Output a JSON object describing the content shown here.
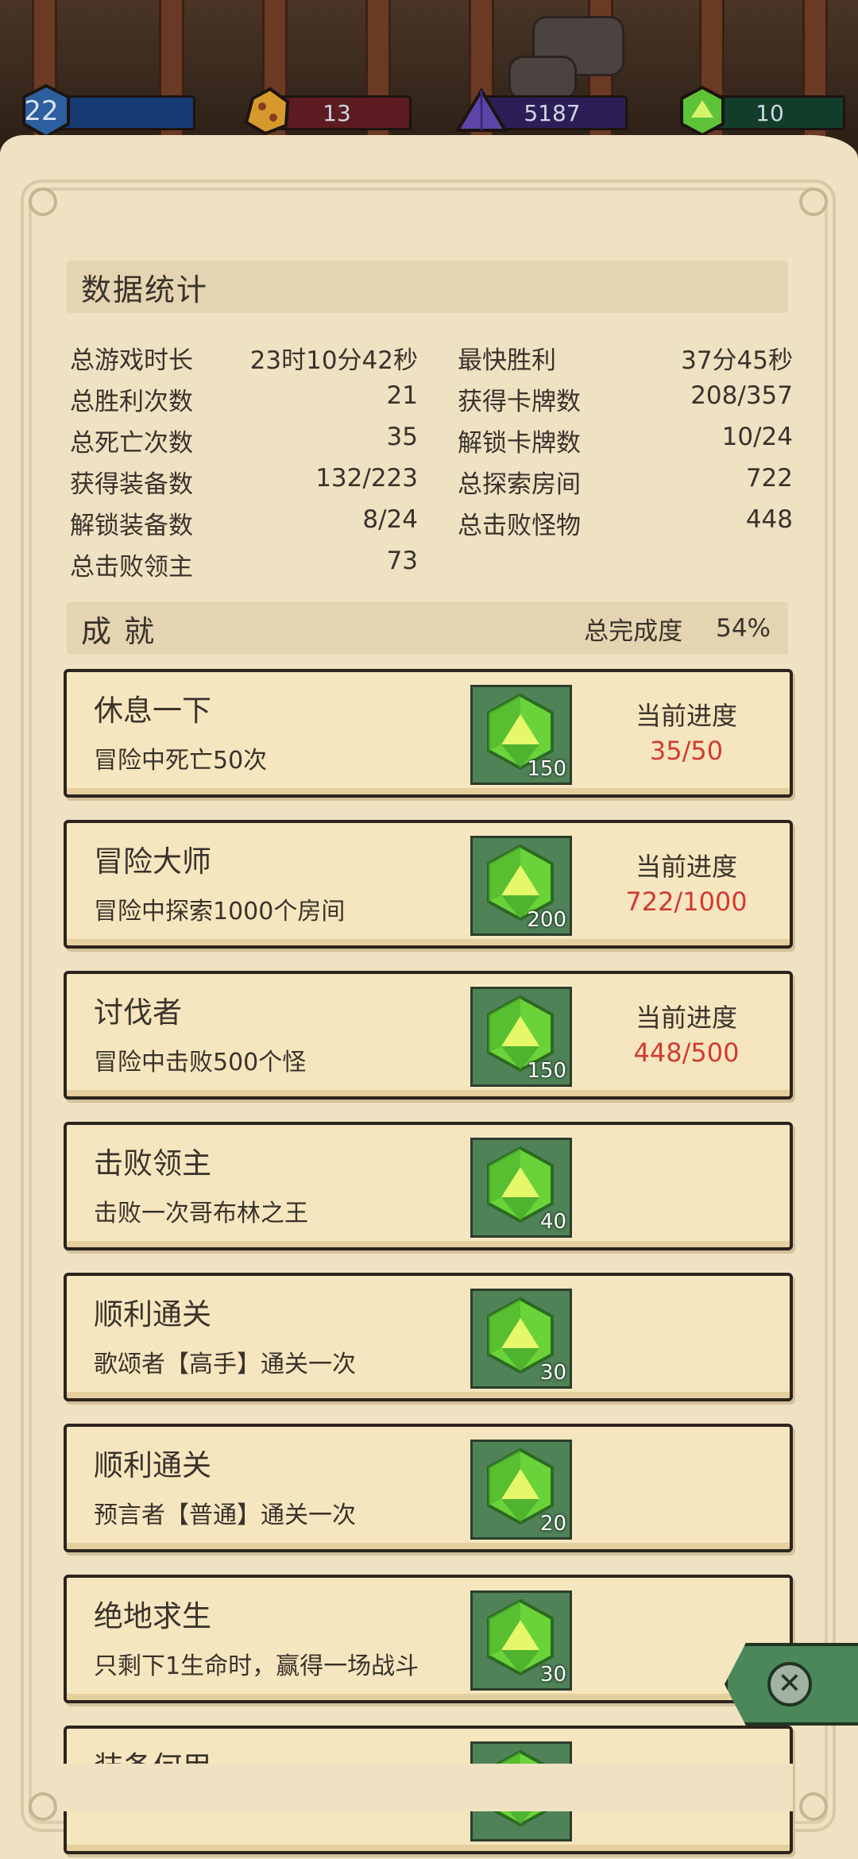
{
  "resources": {
    "level": "22",
    "gold": "13",
    "crystal": "5187",
    "gem": "10",
    "colors": {
      "level": "#173a72",
      "gold": "#5d1b22",
      "crystal": "#2c1f58",
      "gem": "#123d2a"
    }
  },
  "stats": {
    "title": "数据统计",
    "left": [
      {
        "label": "总游戏时长",
        "value": "23时10分42秒"
      },
      {
        "label": "总胜利次数",
        "value": "21"
      },
      {
        "label": "总死亡次数",
        "value": "35"
      },
      {
        "label": "获得装备数",
        "value": "132/223"
      },
      {
        "label": "解锁装备数",
        "value": "8/24"
      },
      {
        "label": "总击败领主",
        "value": "73"
      }
    ],
    "right": [
      {
        "label": "最快胜利",
        "value": "37分45秒"
      },
      {
        "label": "获得卡牌数",
        "value": "208/357"
      },
      {
        "label": "解锁卡牌数",
        "value": "10/24"
      },
      {
        "label": "总探索房间",
        "value": "722"
      },
      {
        "label": "总击败怪物",
        "value": "448"
      }
    ]
  },
  "achievements": {
    "title": "成 就",
    "completion_label": "总完成度",
    "completion_value": "54%",
    "progress_label": "当前进度",
    "items": [
      {
        "title": "休息一下",
        "desc": "冒险中死亡50次",
        "reward": "150",
        "progress": "35/50"
      },
      {
        "title": "冒险大师",
        "desc": "冒险中探索1000个房间",
        "reward": "200",
        "progress": "722/1000"
      },
      {
        "title": "讨伐者",
        "desc": "冒险中击败500个怪",
        "reward": "150",
        "progress": "448/500"
      },
      {
        "title": "击败领主",
        "desc": "击败一次哥布林之王",
        "reward": "40",
        "progress": ""
      },
      {
        "title": "顺利通关",
        "desc": "歌颂者【高手】通关一次",
        "reward": "30",
        "progress": ""
      },
      {
        "title": "顺利通关",
        "desc": "预言者【普通】通关一次",
        "reward": "20",
        "progress": ""
      },
      {
        "title": "绝地求生",
        "desc": "只剩下1生命时，赢得一场战斗",
        "reward": "30",
        "progress": ""
      },
      {
        "title": "装备何用",
        "desc": "",
        "reward": "",
        "progress": ""
      }
    ]
  },
  "icons": {
    "close": "close-icon",
    "gem": "green-gem-icon"
  }
}
